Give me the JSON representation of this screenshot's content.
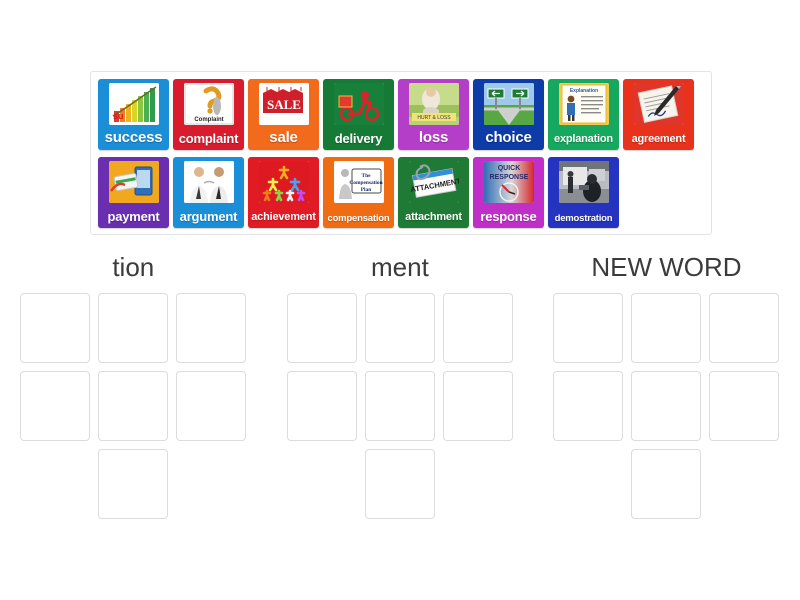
{
  "activity": {
    "type": "group-sort",
    "tray": {
      "name": "word-bank",
      "rows": [
        [
          {
            "label": "success",
            "color": "#1a8fd8",
            "icon": "bar-chart-growth-image",
            "size": "len-s"
          },
          {
            "label": "complaint",
            "color": "#d91b2e",
            "icon": "question-mark-image",
            "size": "len-m"
          },
          {
            "label": "sale",
            "color": "#f26a1b",
            "icon": "sale-tags-image",
            "size": "len-s"
          },
          {
            "label": "delivery",
            "color": "#157a35",
            "icon": "delivery-scooter-image",
            "size": "len-m"
          },
          {
            "label": "loss",
            "color": "#b53ec8",
            "icon": "sad-person-image",
            "size": "len-s"
          },
          {
            "label": "choice",
            "color": "#0d3ca8",
            "icon": "crossroad-signs-image",
            "size": "len-s"
          },
          {
            "label": "explanation",
            "color": "#15a85e",
            "icon": "teacher-poster-image",
            "size": "len-l"
          },
          {
            "label": "agreement",
            "color": "#e8321b",
            "icon": "contract-pen-image",
            "size": "len-l"
          }
        ],
        [
          {
            "label": "payment",
            "color": "#6a2eb0",
            "icon": "card-payment-image",
            "size": "len-m"
          },
          {
            "label": "argument",
            "color": "#1a8fd8",
            "icon": "two-men-arguing-image",
            "size": "len-m"
          },
          {
            "label": "achievement",
            "color": "#e01b24",
            "icon": "people-pyramid-image",
            "size": "len-l"
          },
          {
            "label": "compensation",
            "color": "#ef6c12",
            "icon": "compensation-plan-image",
            "size": "len-xl"
          },
          {
            "label": "attachment",
            "color": "#1e7a35",
            "icon": "paperclip-note-image",
            "size": "len-l"
          },
          {
            "label": "response",
            "color": "#c030c8",
            "icon": "quick-response-image",
            "size": "len-m"
          },
          {
            "label": "demostration",
            "color": "#2434c0",
            "icon": "classroom-demo-image",
            "size": "len-xl"
          }
        ]
      ]
    },
    "columns": [
      {
        "title": "tion",
        "slots": 7
      },
      {
        "title": "ment",
        "slots": 7
      },
      {
        "title": "NEW WORD",
        "slots": 7
      }
    ]
  }
}
